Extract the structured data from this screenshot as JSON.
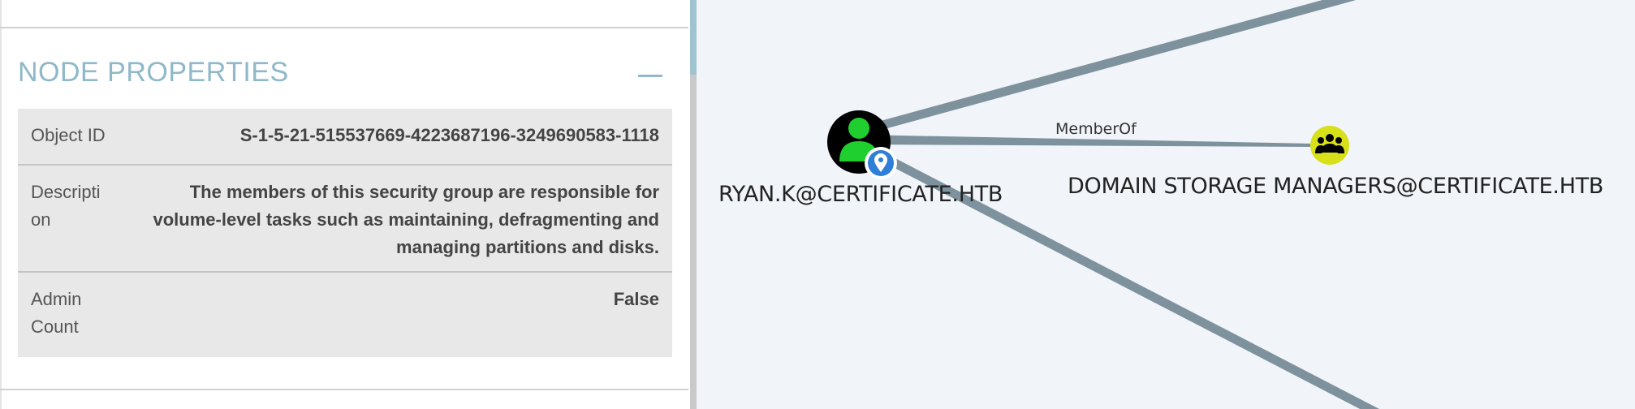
{
  "panel": {
    "section_title": "NODE PROPERTIES",
    "collapse_symbol": "—",
    "properties": [
      {
        "key": "Object ID",
        "value": "S-1-5-21-515537669-4223687196-3249690583-1118"
      },
      {
        "key": "Descripti on",
        "value": "The members of this security group are responsible for volume-level tasks such as maintaining, defragmenting and managing partitions and disks."
      },
      {
        "key": "Admin Count",
        "value": "False"
      }
    ]
  },
  "graph": {
    "user_node": {
      "label": "RYAN.K@CERTIFICATE.HTB",
      "icon": "user-icon",
      "badge": "location-pin-icon",
      "color": "#000000"
    },
    "group_node": {
      "label": "DOMAIN STORAGE MANAGERS@CERTIFICATE.HTB",
      "icon": "group-icon",
      "color": "#d7e019"
    },
    "edge": {
      "label": "MemberOf"
    },
    "colors": {
      "edge": "#7e929e",
      "accent": "#8fb8c9",
      "badge": "#2f7fd8"
    }
  }
}
